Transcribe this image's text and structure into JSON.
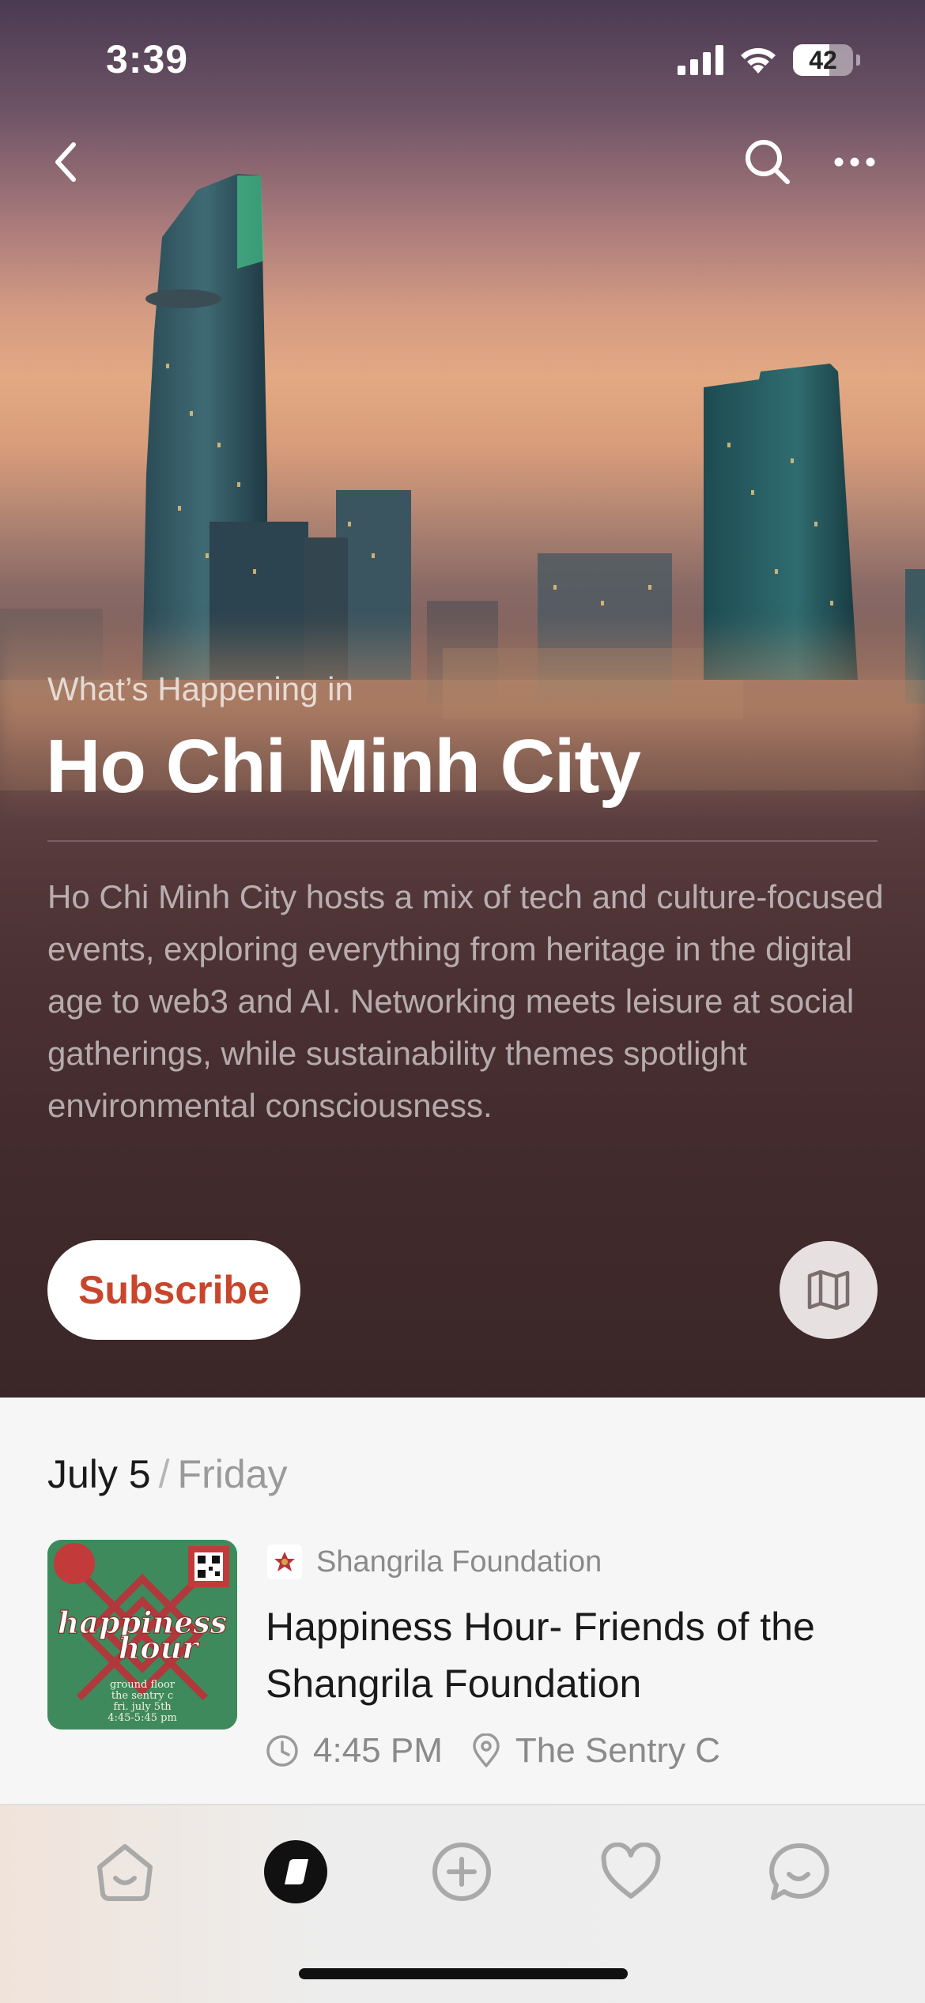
{
  "status_bar": {
    "time": "3:39",
    "battery": "42"
  },
  "hero": {
    "eyebrow": "What’s Happening in",
    "title": "Ho Chi Minh City",
    "description": "Ho Chi Minh City hosts a mix of tech and culture-focused events, exploring everything from heritage in the digital age to web3 and AI. Networking meets leisure at social gatherings, while sustainability themes spotlight environmental consciousness.",
    "subscribe_label": "Subscribe",
    "accent_color": "#c9452b"
  },
  "day": {
    "date": "July 5",
    "separator": "/",
    "weekday": "Friday"
  },
  "event": {
    "organizer": "Shangrila Foundation",
    "title": "Happiness Hour- Friends of the Shangrila Foundation",
    "time": "4:45 PM",
    "location": "The Sentry C",
    "thumbnail": {
      "headline": "happiness hour",
      "line1": "ground floor",
      "line2": "the sentry c",
      "line3": "fri. july 5th",
      "line4": "4:45-5:45 pm"
    }
  },
  "tabs": [
    {
      "icon": "home-icon"
    },
    {
      "icon": "explore-icon",
      "active": true
    },
    {
      "icon": "create-icon"
    },
    {
      "icon": "favorites-icon"
    },
    {
      "icon": "chat-icon"
    }
  ]
}
